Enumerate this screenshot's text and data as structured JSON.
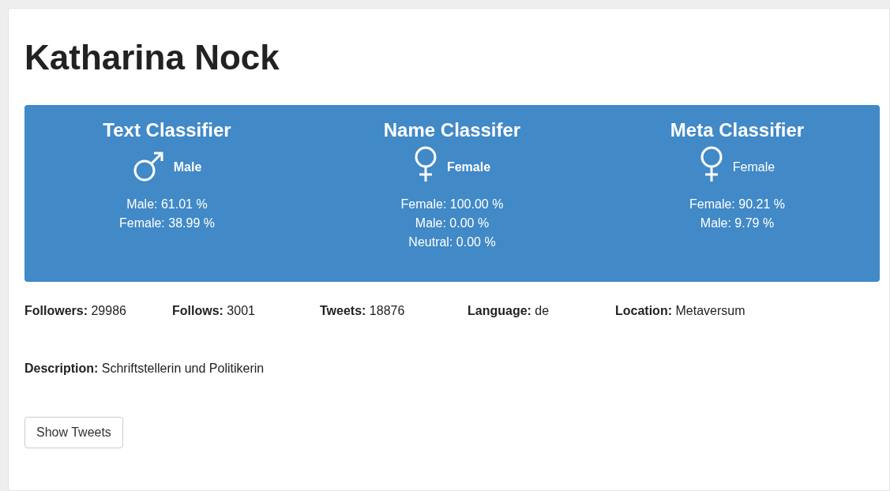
{
  "title": "Katharina Nock",
  "classifiers": [
    {
      "name": "Text Classifier",
      "kind": "male",
      "result": "Male",
      "bold": true,
      "scores": [
        "Male: 61.01 %",
        "Female: 38.99 %"
      ]
    },
    {
      "name": "Name Classifer",
      "kind": "female",
      "result": "Female",
      "bold": true,
      "scores": [
        "Female: 100.00 %",
        "Male: 0.00 %",
        "Neutral: 0.00 %"
      ]
    },
    {
      "name": "Meta Classifier",
      "kind": "female",
      "result": "Female",
      "bold": false,
      "scores": [
        "Female: 90.21 %",
        "Male: 9.79 %"
      ]
    }
  ],
  "stats": [
    {
      "label": "Followers:",
      "value": "29986"
    },
    {
      "label": "Follows:",
      "value": "3001"
    },
    {
      "label": "Tweets:",
      "value": "18876"
    },
    {
      "label": "Language:",
      "value": "de"
    },
    {
      "label": "Location:",
      "value": "Metaversum"
    }
  ],
  "description": {
    "label": "Description:",
    "value": "Schriftstellerin und Politikerin"
  },
  "button": "Show Tweets"
}
